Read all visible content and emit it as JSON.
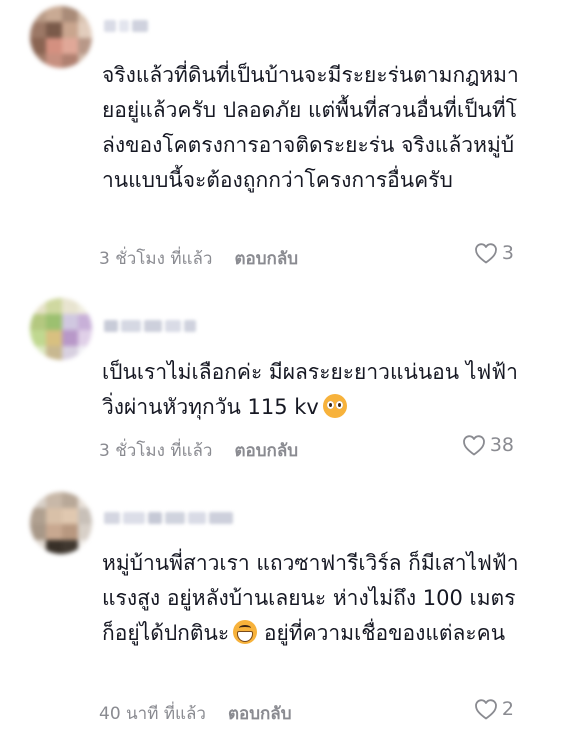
{
  "comments": [
    {
      "text": "จริงแล้วที่ดินที่เป็นบ้านจะมีระยะร่นตามกฎหมายอยู่แล้วครับ ปลอดภัย แต่พื้นที่สวนอื่นที่เป็นที่โล่งของโคตรงการอาจติดระยะร่น จริงแล้วหมู่บ้านแบบนี้จะต้องถูกกว่าโครงการอื่นครับ",
      "time": "3 ชั่วโมง ที่แล้ว",
      "reply": "ตอบกลับ",
      "likes": "3"
    },
    {
      "text": "เป็นเราไม่เลือกค่ะ มีผลระยะยาวแน่นอน ไฟฟ้าวิ่งผ่านหัวทุกวัน 115 kv",
      "emoji": "pleading-face",
      "time": "3 ชั่วโมง ที่แล้ว",
      "reply": "ตอบกลับ",
      "likes": "38"
    },
    {
      "text_before": "หมู่บ้านพี่สาวเรา แถวซาฟารีเวิร์ล ก็มีเสาไฟฟ้าแรงสูง อยู่หลังบ้านเลยนะ ห่างไม่ถึง 100 เมตร ก็อยู่ได้ปกตินะ",
      "emoji": "grinning-face",
      "text_after": "  อยู่ที่ความเชื่อของแต่ละคน",
      "time": "40 นาที ที่แล้ว",
      "reply": "ตอบกลับ",
      "likes": "2"
    }
  ],
  "icons": {
    "like": "heart-outline-icon"
  },
  "colors": {
    "text": "#161823",
    "meta": "#8a8b91"
  }
}
